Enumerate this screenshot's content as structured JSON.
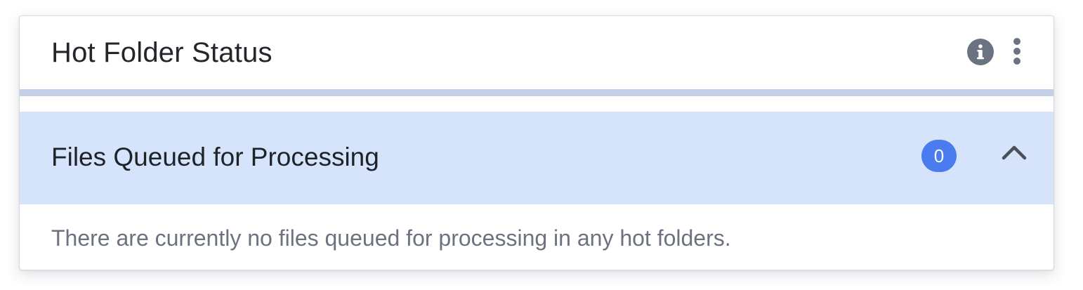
{
  "widget": {
    "title": "Hot Folder Status",
    "icons": {
      "info": "info-icon",
      "menu": "kebab-menu-icon"
    }
  },
  "section": {
    "title": "Files Queued for Processing",
    "count": "0",
    "expanded": true,
    "toggle_icon": "chevron-up-icon",
    "empty_message": "There are currently no files queued for processing in any hot folders."
  },
  "colors": {
    "section_background": "#d5e4fb",
    "header_rule": "#c2cfe4",
    "badge": "#4a7cf0",
    "icon": "#6b7280"
  }
}
